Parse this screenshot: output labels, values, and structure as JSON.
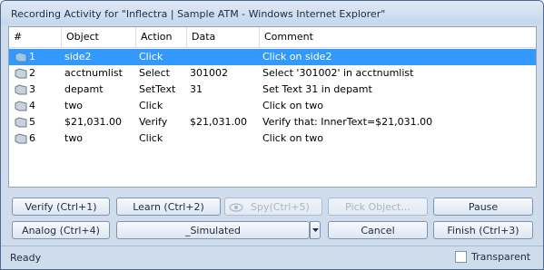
{
  "window": {
    "title": "Recording Activity for \"Inflectra | Sample ATM - Windows Internet Explorer\""
  },
  "table": {
    "headers": [
      "#",
      "Object",
      "Action",
      "Data",
      "Comment"
    ],
    "rows": [
      {
        "num": "1",
        "object": "side2",
        "action": "Click",
        "data": "",
        "comment": "Click on side2",
        "selected": true
      },
      {
        "num": "2",
        "object": "acctnumlist",
        "action": "Select",
        "data": "301002",
        "comment": "Select '301002' in acctnumlist",
        "selected": false
      },
      {
        "num": "3",
        "object": "depamt",
        "action": "SetText",
        "data": "31",
        "comment": "Set Text 31 in depamt",
        "selected": false
      },
      {
        "num": "4",
        "object": "two",
        "action": "Click",
        "data": "",
        "comment": "Click on two",
        "selected": false
      },
      {
        "num": "5",
        "object": "$21,031.00",
        "action": "Verify",
        "data": "$21,031.00",
        "comment": "Verify that: InnerText=$21,031.00",
        "selected": false
      },
      {
        "num": "6",
        "object": "two",
        "action": "Click",
        "data": "",
        "comment": "Click on two",
        "selected": false
      }
    ]
  },
  "buttons": {
    "verify": "Verify (Ctrl+1)",
    "learn": "Learn (Ctrl+2)",
    "spy": "Spy(Ctrl+5)",
    "pick_object": "Pick Object...",
    "pause": "Pause",
    "analog": "Analog (Ctrl+4)",
    "simulated": "_Simulated",
    "cancel": "Cancel",
    "finish": "Finish (Ctrl+3)"
  },
  "status": {
    "text": "Ready",
    "transparent_label": "Transparent",
    "transparent_checked": false
  },
  "colors": {
    "selection": "#3399ff",
    "frame": "#cfdcec"
  }
}
